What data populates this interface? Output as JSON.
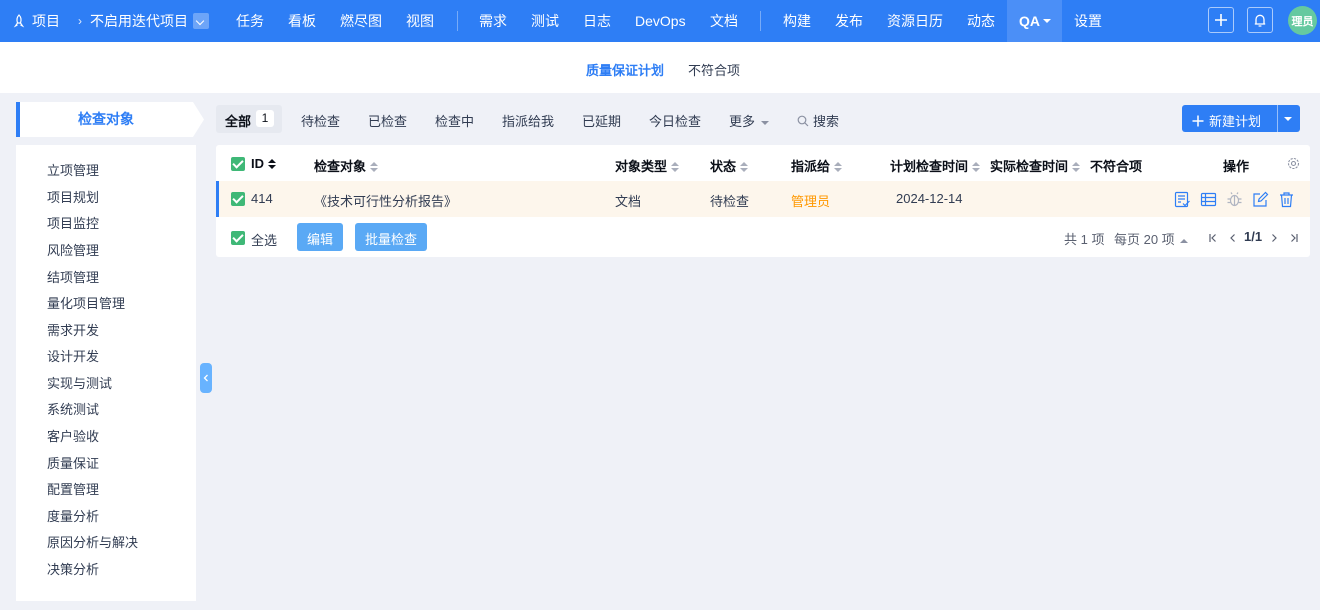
{
  "topbar": {
    "project_label": "项目",
    "current_project": "不启用迭代项目",
    "nav": [
      "任务",
      "看板",
      "燃尽图",
      "视图",
      "需求",
      "测试",
      "日志",
      "DevOps",
      "文档",
      "构建",
      "发布",
      "资源日历",
      "动态",
      "QA",
      "设置"
    ],
    "avatar_text": "理员"
  },
  "subnav": {
    "plan": "质量保证计划",
    "nonconform": "不符合项"
  },
  "sidebar": {
    "title": "检查对象",
    "items": [
      "立项管理",
      "项目规划",
      "项目监控",
      "风险管理",
      "结项管理",
      "量化项目管理",
      "需求开发",
      "设计开发",
      "实现与测试",
      "系统测试",
      "客户验收",
      "质量保证",
      "配置管理",
      "度量分析",
      "原因分析与解决",
      "决策分析"
    ]
  },
  "filters": {
    "all": "全部",
    "all_count": "1",
    "tabs": [
      "待检查",
      "已检查",
      "检查中",
      "指派给我",
      "已延期",
      "今日检查"
    ],
    "more": "更多",
    "search": "搜索",
    "new_plan": "新建计划"
  },
  "table": {
    "headers": {
      "id": "ID",
      "object": "检查对象",
      "type": "对象类型",
      "status": "状态",
      "assigned": "指派给",
      "planned_time": "计划检查时间",
      "actual_time": "实际检查时间",
      "nonconform": "不符合项",
      "actions": "操作"
    },
    "rows": [
      {
        "id": "414",
        "object": "《技术可行性分析报告》",
        "type": "文档",
        "status": "待检查",
        "assigned": "管理员",
        "planned_time": "2024-12-14",
        "actual_time": "",
        "nonconform": ""
      }
    ],
    "footer": {
      "select_all": "全选",
      "edit": "编辑",
      "batch_check": "批量检查",
      "total": "共 1 项",
      "per_page": "每页 20 项",
      "page": "1/1"
    }
  },
  "colors": {
    "primary": "#2e7ef5",
    "assigned_text": "#ff9800",
    "row_highlight": "#fdf6ec",
    "checkbox": "#3fb877"
  }
}
